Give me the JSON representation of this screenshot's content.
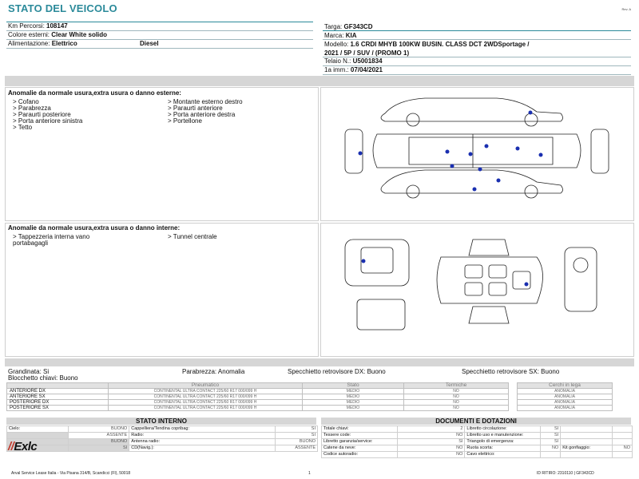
{
  "header": {
    "title": "STATO DEL VEICOLO",
    "rev": "Rev. A",
    "left_rows": [
      {
        "label": "Km Percorsi:",
        "value": "108147",
        "extra": ""
      },
      {
        "label": "Colore esterni:",
        "value": "Clear White solido",
        "extra": ""
      },
      {
        "label": "Alimentazione:",
        "value": "Elettrico",
        "extra": "Diesel"
      }
    ],
    "right_rows": [
      {
        "label": "Targa:",
        "value": "GF343CD"
      },
      {
        "label": "Marca:",
        "value": "KIA"
      },
      {
        "label": "Modello:",
        "value": "1.6 CRDI MHYB 100KW BUSIN. CLASS DCT 2WDSportage /"
      },
      {
        "label": "",
        "value": "2021 / 5P / SUV / (PROMO 1)"
      },
      {
        "label": "Telaio N.:",
        "value": "U5001834"
      },
      {
        "label": "1a imm.:",
        "value": "07/04/2021"
      }
    ]
  },
  "external": {
    "title": "Anomalie da normale usura,extra usura o danno esterne:",
    "col1": [
      "> Cofano",
      "> Parabrezza",
      "> Paraurti posteriore",
      "> Porta anteriore sinistra",
      "> Tetto"
    ],
    "col2": [
      "> Montante esterno destro",
      "> Paraurti anteriore",
      "> Porta anteriore destra",
      "> Portellone"
    ]
  },
  "internal": {
    "title": "Anomalie da normale usura,extra usura o danno interne:",
    "col1": [
      "> Tappezzeria interna vano",
      "portabagagli"
    ],
    "col2": [
      "> Tunnel centrale"
    ]
  },
  "mid": {
    "grandinata": "Grandinata: Si",
    "bloccaggio": "Blocchetto chiavi: Buono",
    "parabrezza": "Parabrezza: Anomalia",
    "spec_dx": "Specchietto retrovisore DX: Buono",
    "spec_sx": "Specchietto retrovisore SX: Buono"
  },
  "tyres": {
    "headers": [
      "Pneumatico",
      "Stato",
      "Termiche",
      "Cerchi in lega"
    ],
    "rows": [
      {
        "pos": "ANTERIORE DX",
        "tyre": "CONTINENTAL ULTRA CONTACT 225/60 R17 000/099 H",
        "stato": "MEDIO",
        "term": "NO",
        "cerchi": "ANOMALIA"
      },
      {
        "pos": "ANTERIORE SX",
        "tyre": "CONTINENTAL ULTRA CONTACT 225/60 R17 000/099 H",
        "stato": "MEDIO",
        "term": "NO",
        "cerchi": "ANOMALIA"
      },
      {
        "pos": "POSTERIORE DX",
        "tyre": "CONTINENTAL ULTRA CONTACT 225/60 R17 000/099 H",
        "stato": "MEDIO",
        "term": "NO",
        "cerchi": "ANOMALIA"
      },
      {
        "pos": "POSTERIORE SX",
        "tyre": "CONTINENTAL ULTRA CONTACT 225/60 R17 000/099 H",
        "stato": "MEDIO",
        "term": "NO",
        "cerchi": "ANOMALIA"
      }
    ]
  },
  "stato_interno": {
    "title": "STATO INTERNO",
    "rows": [
      [
        "Cielo:",
        "BUONO",
        "Cappelliera/Tendina copribag:",
        "SI"
      ],
      [
        "",
        "ASSENTE",
        "Radio:",
        "SI"
      ],
      [
        "",
        "BUONO",
        "Antenna radio:",
        "BUONO"
      ],
      [
        "",
        "SI",
        "CD(Navig.):",
        "ASSENTE"
      ]
    ]
  },
  "documenti": {
    "title": "DOCUMENTI E DOTAZIONI",
    "rows": [
      [
        "Totale chiavi:",
        "2",
        "Libretto circolazione:",
        "SI",
        "",
        ""
      ],
      [
        "Tessere code:",
        "NO",
        "Libretto uso e manutenzione:",
        "SI",
        "",
        ""
      ],
      [
        "Libretto garanzia/service:",
        "SI",
        "Triangolo di emergenza:",
        "SI",
        "",
        ""
      ],
      [
        "Catene da neve:",
        "NO",
        "Ruota scorta:",
        "NO",
        "Kit gonfiaggio:",
        "NO"
      ],
      [
        "Codice autoradio:",
        "NO",
        "Cavo elettrico:",
        "",
        "",
        ""
      ]
    ]
  },
  "logo": {
    "text": "Exlc",
    "prefix": "//"
  },
  "footer": {
    "company": "Arval Service Lease Italia - Via Pisana 314/B, Scandicci (FI), 50018",
    "page": "1",
    "id": "ID RITIRO: 2310110 | GF343CD"
  }
}
